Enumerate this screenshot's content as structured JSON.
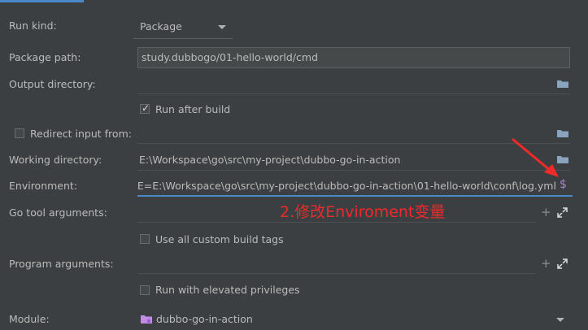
{
  "rows": {
    "run_kind": {
      "label": "Run kind:",
      "value": "Package"
    },
    "package_path": {
      "label": "Package path:",
      "value": "study.dubbogo/01-hello-world/cmd"
    },
    "output_directory": {
      "label": "Output directory:",
      "value": ""
    },
    "run_after_build": {
      "label": "Run after build",
      "checked": true
    },
    "redirect_input": {
      "label": "Redirect input from:",
      "checked": false,
      "value": ""
    },
    "working_directory": {
      "label": "Working directory:",
      "value": "E:\\Workspace\\go\\src\\my-project\\dubbo-go-in-action"
    },
    "environment": {
      "label": "Environment:",
      "value": "FILE=E:\\Workspace\\go\\src\\my-project\\dubbo-go-in-action\\01-hello-world\\conf\\log.yml"
    },
    "go_tool_arguments": {
      "label": "Go tool arguments:",
      "value": ""
    },
    "use_custom_build_tags": {
      "label": "Use all custom build tags",
      "checked": false
    },
    "program_arguments": {
      "label": "Program arguments:",
      "value": ""
    },
    "elevated_privileges": {
      "label": "Run with elevated privileges",
      "checked": false
    },
    "module": {
      "label": "Module:",
      "value": "dubbo-go-in-action"
    }
  },
  "annotation": {
    "text": "2.修改Enviroment变量",
    "color": "#ee2a2a"
  },
  "icons": {
    "folder": "folder-icon",
    "dollar": "$",
    "plus": "+",
    "expand": "expand-icon"
  },
  "colors": {
    "accent": "#4a88c7",
    "annotation": "#ee2a2a",
    "folder": "#8aa4bd",
    "module": "#c18de3"
  }
}
